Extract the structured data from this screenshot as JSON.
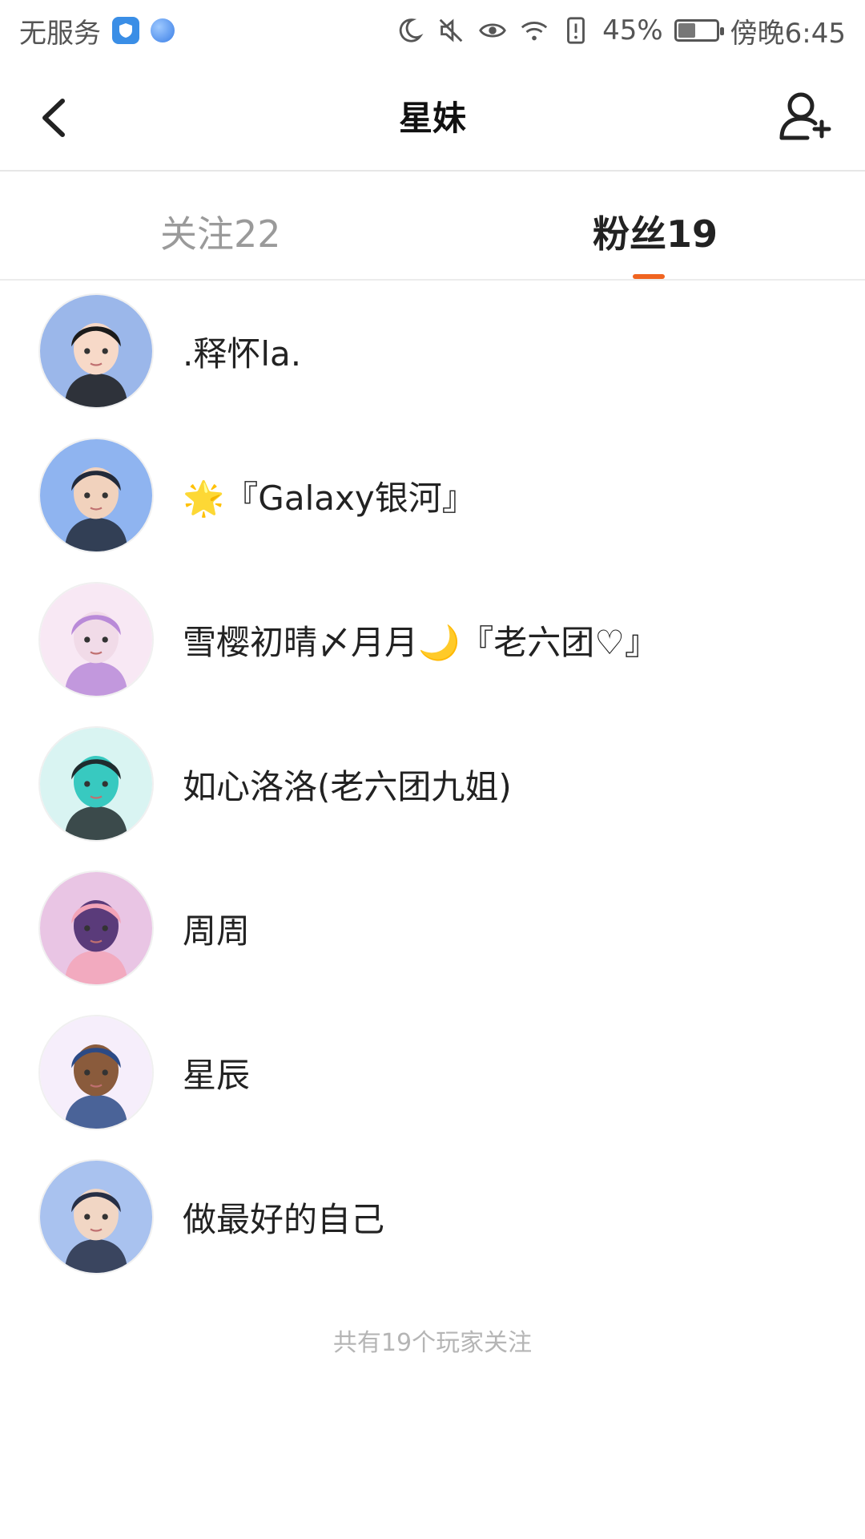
{
  "status_bar": {
    "carrier": "无服务",
    "battery_percent": "45%",
    "time": "傍晚6:45",
    "battery_level": 0.45
  },
  "header": {
    "title": "星妹"
  },
  "tabs": [
    {
      "label": "关注22",
      "active": false
    },
    {
      "label": "粉丝19",
      "active": true
    }
  ],
  "accent_color": "#f06420",
  "followers": [
    {
      "name": ".释怀la.",
      "avatar_colors": [
        "#9bb7ea",
        "#1b1b1b",
        "#f7d9c8"
      ]
    },
    {
      "name": "🌟『Galaxy银河』",
      "avatar_colors": [
        "#8fb4f0",
        "#222a3a",
        "#f1d2bd"
      ]
    },
    {
      "name": "雪樱初晴〆月月🌙『老六团♡』",
      "avatar_colors": [
        "#f8e8f4",
        "#b98ad8",
        "#f1dbe8"
      ]
    },
    {
      "name": "如心洛洛(老六团九姐)",
      "avatar_colors": [
        "#d9f4f2",
        "#1f2b2e",
        "#38c9c0"
      ]
    },
    {
      "name": "周周",
      "avatar_colors": [
        "#e9c5e4",
        "#f3a4b8",
        "#5a3b7a"
      ]
    },
    {
      "name": "星辰",
      "avatar_colors": [
        "#f6eefb",
        "#2b4a86",
        "#8a5b3c"
      ]
    },
    {
      "name": "做最好的自己",
      "avatar_colors": [
        "#a9c2ef",
        "#272f45",
        "#f1d6c4"
      ]
    }
  ],
  "footer_text": "共有19个玩家关注"
}
